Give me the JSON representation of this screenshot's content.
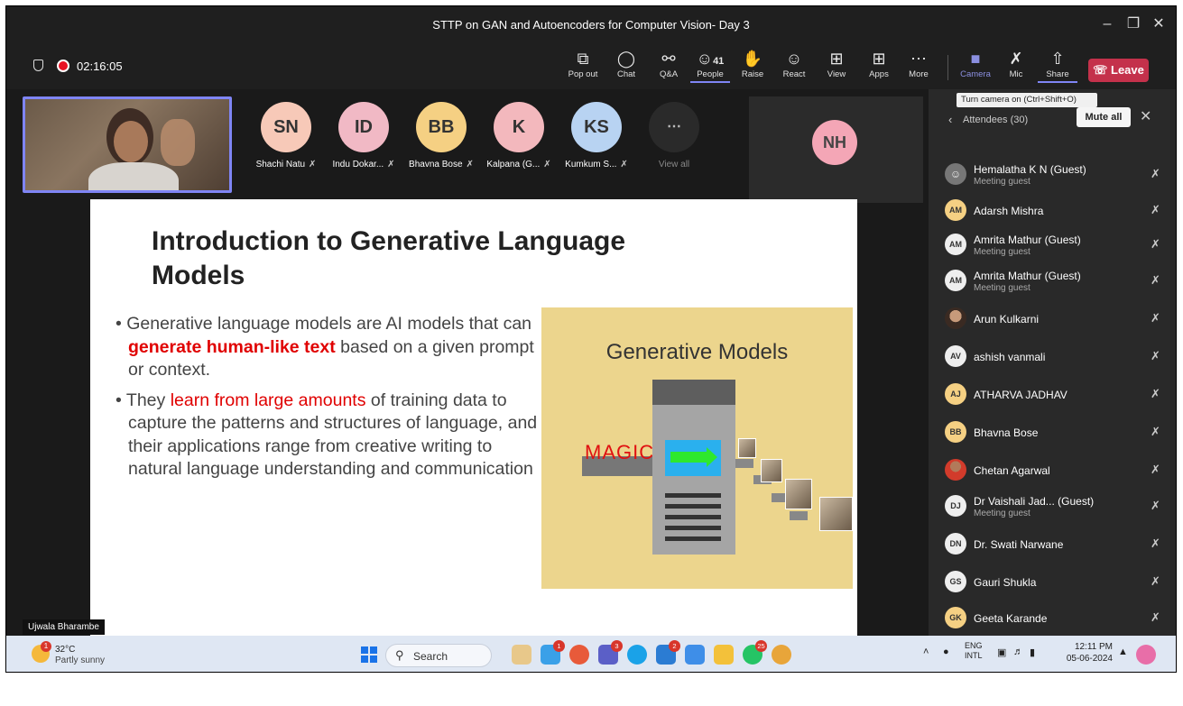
{
  "window": {
    "title": "STTP on GAN and Autoencoders for Computer Vision- Day 3",
    "min_icon": "minimize-icon",
    "max_icon": "restore-icon",
    "close_icon": "close-icon"
  },
  "toolbar": {
    "timer": "02:16:05",
    "buttons": [
      {
        "label": "Pop out",
        "icon": "popout-icon"
      },
      {
        "label": "Chat",
        "icon": "chat-icon"
      },
      {
        "label": "Q&A",
        "icon": "qa-icon"
      },
      {
        "label": "People",
        "icon": "people-icon",
        "count": "41"
      },
      {
        "label": "Raise",
        "icon": "raise-hand-icon"
      },
      {
        "label": "React",
        "icon": "react-icon"
      },
      {
        "label": "View",
        "icon": "view-icon"
      },
      {
        "label": "Apps",
        "icon": "apps-icon"
      },
      {
        "label": "More",
        "icon": "more-icon"
      },
      {
        "label": "Camera",
        "icon": "camera-off-icon"
      },
      {
        "label": "Mic",
        "icon": "mic-off-icon"
      },
      {
        "label": "Share",
        "icon": "share-icon"
      }
    ],
    "leave_label": "Leave",
    "accent": "#7f85f5",
    "leave_color": "#c4314b"
  },
  "stage": {
    "participants": [
      {
        "initials": "SN",
        "name": "Shachi Natu",
        "color": "#f7c9b8"
      },
      {
        "initials": "ID",
        "name": "Indu Dokar...",
        "color": "#f1b9c5"
      },
      {
        "initials": "BB",
        "name": "Bhavna Bose",
        "color": "#f5d083"
      },
      {
        "initials": "K",
        "name": "Kalpana (G...",
        "color": "#f3b8bd"
      },
      {
        "initials": "KS",
        "name": "Kumkum S...",
        "color": "#b8d3f2"
      }
    ],
    "view_all_label": "View all",
    "nh_initials": "NH",
    "presenter_name": "Ujwala Bharambe"
  },
  "slide": {
    "title": "Introduction to Generative Language Models",
    "b1_pre": "Generative language models are AI models that can ",
    "b1_highlight": "generate human-like text",
    "b1_post": " based on a given prompt or context.",
    "b2_pre": "They ",
    "b2_highlight": "learn from large amounts",
    "b2_post": " of training data to capture the patterns and structures of language, and their applications range from creative writing to natural language understanding and communication",
    "figure_title": "Generative Models",
    "figure_label": "MAGIC"
  },
  "panel": {
    "tooltip": "Turn camera on (Ctrl+Shift+O)",
    "title": "Attendees (30)",
    "mute_all": "Mute all",
    "attendees": [
      {
        "initials": "",
        "name": "Hemalatha K N (Guest)",
        "sub": "Meeting guest",
        "color": "#777777",
        "type": "guest"
      },
      {
        "initials": "AM",
        "name": "Adarsh Mishra",
        "sub": "",
        "color": "#f5d083"
      },
      {
        "initials": "AM",
        "name": "Amrita Mathur (Guest)",
        "sub": "Meeting guest",
        "color": "#eeeeee"
      },
      {
        "initials": "AM",
        "name": "Amrita Mathur (Guest)",
        "sub": "Meeting guest",
        "color": "#eeeeee"
      },
      {
        "initials": "",
        "name": "Arun Kulkarni",
        "sub": "",
        "color": "#b08060",
        "type": "photo"
      },
      {
        "initials": "AV",
        "name": "ashish vanmali",
        "sub": "",
        "color": "#eeeeee"
      },
      {
        "initials": "AJ",
        "name": "ATHARVA JADHAV",
        "sub": "",
        "color": "#f5d083"
      },
      {
        "initials": "BB",
        "name": "Bhavna Bose",
        "sub": "",
        "color": "#f5d083"
      },
      {
        "initials": "",
        "name": "Chetan Agarwal",
        "sub": "",
        "color": "#d23b2b",
        "type": "cg"
      },
      {
        "initials": "DJ",
        "name": "Dr Vaishali Jad... (Guest)",
        "sub": "Meeting guest",
        "color": "#eeeeee"
      },
      {
        "initials": "DN",
        "name": "Dr. Swati Narwane",
        "sub": "",
        "color": "#eeeeee"
      },
      {
        "initials": "GS",
        "name": "Gauri Shukla",
        "sub": "",
        "color": "#eeeeee"
      },
      {
        "initials": "GK",
        "name": "Geeta Karande",
        "sub": "",
        "color": "#f5d083"
      }
    ]
  },
  "taskbar": {
    "temp": "32°C",
    "weather": "Partly sunny",
    "weather_badge": "1",
    "search_label": "Search",
    "lang_top": "ENG",
    "lang_bottom": "INTL",
    "time": "12:11 PM",
    "date": "05-06-2024",
    "app_badges": [
      "1",
      "3",
      "2",
      "25"
    ]
  }
}
